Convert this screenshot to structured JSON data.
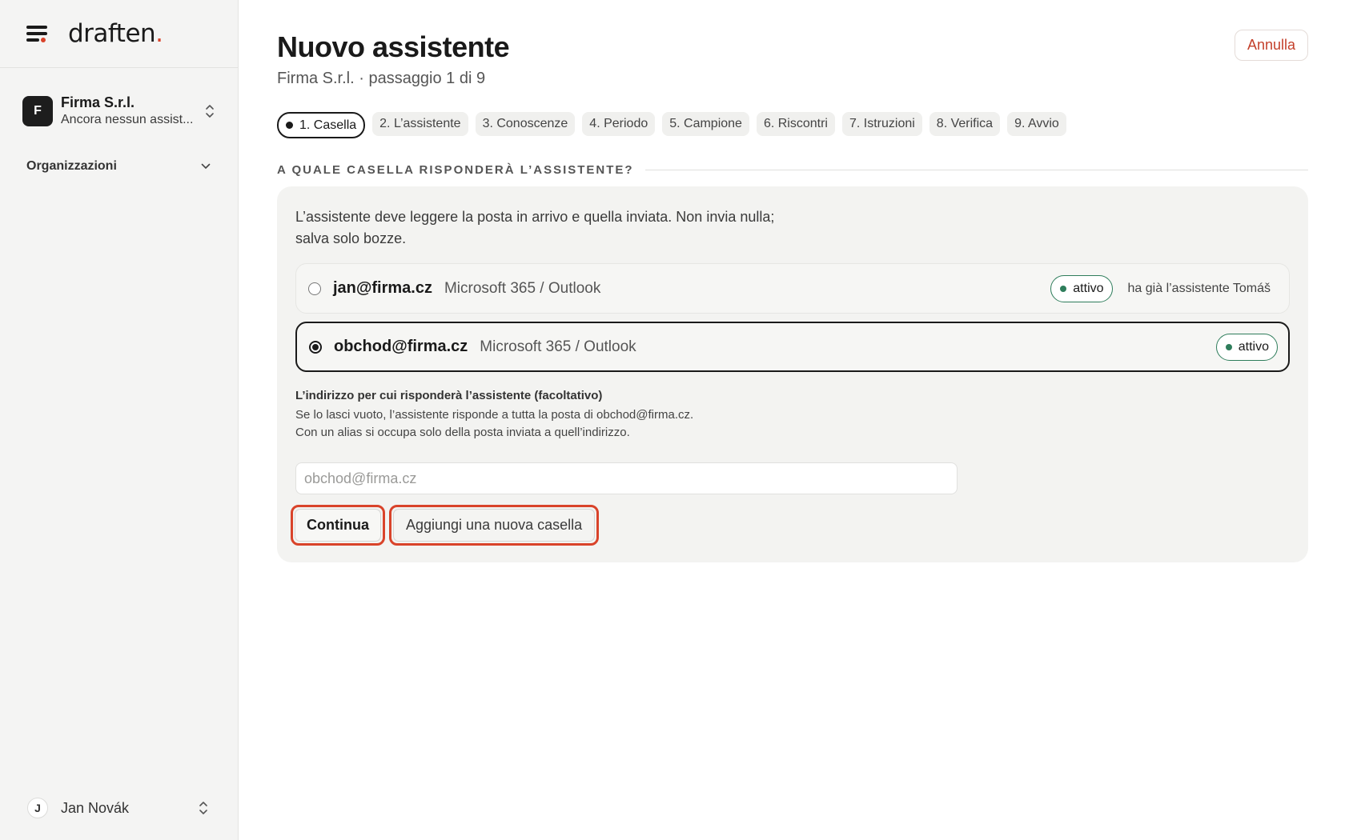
{
  "sidebar": {
    "logo_text": "draften",
    "logo_dot": ".",
    "org": {
      "initial": "F",
      "name": "Firma S.r.l.",
      "subtitle": "Ancora nessun assist..."
    },
    "section_label": "Organizzazioni",
    "user": {
      "initial": "J",
      "name": "Jan Novák"
    }
  },
  "header": {
    "title": "Nuovo assistente",
    "subtitle": "Firma S.r.l. · passaggio 1 di 9",
    "cancel_label": "Annulla"
  },
  "steps": [
    {
      "label": "1. Casella",
      "active": true
    },
    {
      "label": "2. L’assistente",
      "active": false
    },
    {
      "label": "3. Conoscenze",
      "active": false
    },
    {
      "label": "4. Periodo",
      "active": false
    },
    {
      "label": "5. Campione",
      "active": false
    },
    {
      "label": "6. Riscontri",
      "active": false
    },
    {
      "label": "7. Istruzioni",
      "active": false
    },
    {
      "label": "8. Verifica",
      "active": false
    },
    {
      "label": "9. Avvio",
      "active": false
    }
  ],
  "section": {
    "heading": "A QUALE CASELLA RISPONDERÀ L’ASSISTENTE?",
    "intro": "L’assistente deve leggere la posta in arrivo e quella inviata. Non invia nulla; salva solo bozze."
  },
  "mailboxes": [
    {
      "email": "jan@firma.cz",
      "provider": "Microsoft 365 / Outlook",
      "status": "attivo",
      "note": "ha già l’assistente Tomáš",
      "selected": false
    },
    {
      "email": "obchod@firma.cz",
      "provider": "Microsoft 365 / Outlook",
      "status": "attivo",
      "note": "",
      "selected": true
    }
  ],
  "alias_field": {
    "label": "L’indirizzo per cui risponderà l’assistente (facoltativo)",
    "help": "Se lo lasci vuoto, l’assistente risponde a tutta la posta di obchod@firma.cz. Con un alias si occupa solo della posta inviata a quell’indirizzo.",
    "value": "",
    "placeholder": "obchod@firma.cz"
  },
  "actions": {
    "continue_label": "Continua",
    "add_mailbox_label": "Aggiungi una nuova casella"
  },
  "colors": {
    "accent": "#d9432a",
    "status_green": "#2e7d5b",
    "sidebar_bg": "#f4f4f3",
    "card_bg": "#f3f3f1"
  }
}
